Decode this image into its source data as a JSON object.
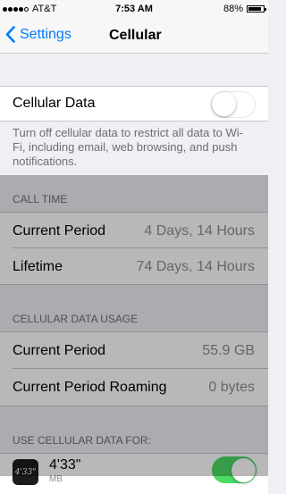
{
  "status_bar": {
    "carrier": "AT&T",
    "time": "7:53 AM",
    "battery": "88%",
    "battery_level": 0.88,
    "signal_bars_filled": 4,
    "signal_bars_total": 5
  },
  "nav": {
    "back_label": "Settings",
    "title": "Cellular"
  },
  "cellular_data": {
    "label": "Cellular Data",
    "enabled": false,
    "footer": "Turn off cellular data to restrict all data to Wi-Fi, including email, web browsing, and push notifications."
  },
  "call_time": {
    "header": "CALL TIME",
    "rows": [
      {
        "label": "Current Period",
        "value": "4 Days, 14 Hours"
      },
      {
        "label": "Lifetime",
        "value": "74 Days, 14 Hours"
      }
    ]
  },
  "usage": {
    "header": "CELLULAR DATA USAGE",
    "rows": [
      {
        "label": "Current Period",
        "value": "55.9 GB"
      },
      {
        "label": "Current Period Roaming",
        "value": "0 bytes"
      }
    ]
  },
  "use_for": {
    "header": "USE CELLULAR DATA FOR:",
    "apps": [
      {
        "icon_text": "4'33\"",
        "name": "4'33\"",
        "subtitle": "MB",
        "enabled": true
      }
    ]
  },
  "colors": {
    "accent": "#007aff",
    "switch_on": "#4cd964",
    "background": "#efeff4"
  }
}
